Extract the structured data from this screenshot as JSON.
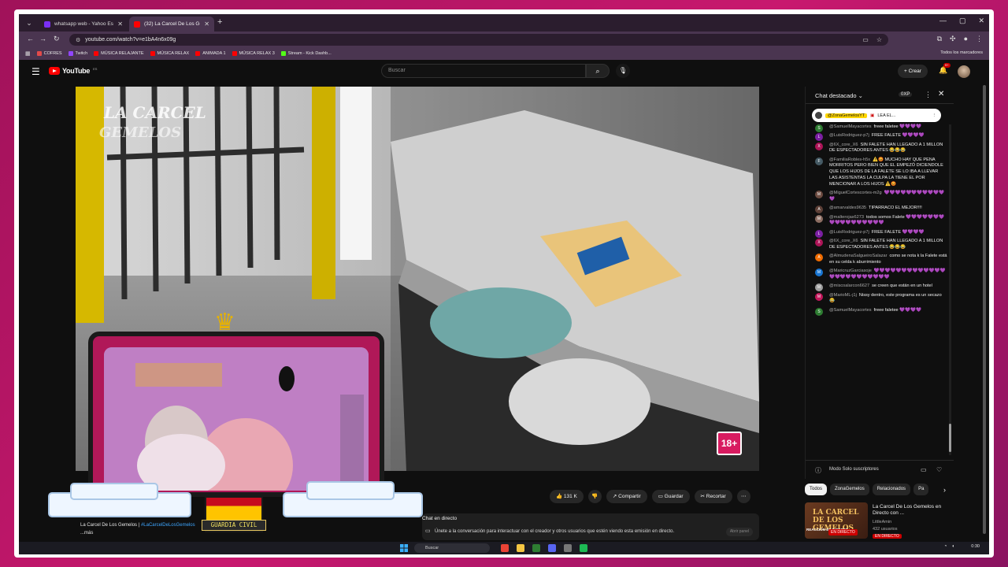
{
  "browser": {
    "tabs": [
      {
        "title": "whatsapp web - Yahoo España",
        "favicon_color": "#7b2ff7"
      },
      {
        "title": "(32) La Carcel De Los Gemel",
        "favicon_color": "#ff0000"
      }
    ],
    "url": "youtube.com/watch?v=e1bA4n6x09g",
    "bookmarks": [
      {
        "label": "COFRES",
        "color": "#e24a4a"
      },
      {
        "label": "Twitch",
        "color": "#9146ff"
      },
      {
        "label": "MÚSICA RELAJANTE",
        "color": "#ff0000"
      },
      {
        "label": "MÚSICA RELAX",
        "color": "#ff0000"
      },
      {
        "label": "ANIMADA 1",
        "color": "#ff0000"
      },
      {
        "label": "MÚSICA RELAX 3",
        "color": "#ff0000"
      },
      {
        "label": "Stream - Kick Dashb...",
        "color": "#53fc18"
      }
    ],
    "all_bookmarks": "Todos los marcadores"
  },
  "youtube": {
    "logo": "YouTube",
    "logo_region": "ES",
    "search_placeholder": "Buscar",
    "create_label": "+ Crear",
    "notif_count": "9+"
  },
  "video": {
    "age_badge": "18+",
    "overlay_label": "GUARDIA CIVIL",
    "actions": {
      "likes": "131 K",
      "share": "Compartir",
      "save": "Guardar",
      "clip": "Recortar"
    }
  },
  "description": {
    "title_prefix": "La Carcel De Los Gemelos |",
    "hashtag": "#LaCarcelDeLosGemelos",
    "more": "...más"
  },
  "live_chat_info": {
    "title": "Chat en directo",
    "text": "Únete a la conversación para interactuar con el creador y otros usuarios que estén viendo esta emisión en directo.",
    "button": "Abrir panel"
  },
  "chat": {
    "title": "Chat destacado",
    "xp": "0XP",
    "pinned_user": "@ZonaGemelosYT",
    "pinned_text": "LEA EL...",
    "messages": [
      {
        "initial": "S",
        "color": "#2e7d32",
        "author": "@SamuelMayacortes",
        "text": "freee faletee 💜💜💜💜"
      },
      {
        "initial": "L",
        "color": "#7b1fa2",
        "author": "@LuisRodriguez-p7j",
        "text": "FREE FALETE 💜💜💜💜"
      },
      {
        "initial": "X",
        "color": "#ad1457",
        "author": "@6X_core_X6",
        "text": "SIN FALETE HAN LLEGADO A 1 MILLON DE ESPECTADORES ANTES 😂😂😂"
      },
      {
        "initial": "F",
        "color": "#455a64",
        "author": "@FamiliaRobles-h5x",
        "text": "⚠️😡 MUCHO HAY QUE PENA MORRITOS PERO BIEN QUE EL EMPEZÓ DICIENDOLE QUE LOS HIJOS DE LA FALETE SE LO IBA A LLEVAR LAS ASISTENTAS LA CULPA LA TIENE EL POR MENCIONAR A LOS HIJOS ⚠️😡"
      },
      {
        "initial": "M",
        "color": "#6d4c41",
        "author": "@MiguelCortescortes-m2g",
        "text": "💜💜💜💜💜💜💜💜💜💜💜💜"
      },
      {
        "initial": "A",
        "color": "#5d4037",
        "author": "@amarvaldes9635",
        "text": "TIPARRACO EL MEJOR!!!!"
      },
      {
        "initial": "M",
        "color": "#8d6e63",
        "author": "@malterojas6273",
        "text": "todos somos Falete 💜💜💜💜💜💜💜💜💜💜💜💜💜💜💜💜💜"
      },
      {
        "initial": "L",
        "color": "#7b1fa2",
        "author": "@LuisRodriguez-p7j",
        "text": "FREE FALETE 💜💜💜💜"
      },
      {
        "initial": "X",
        "color": "#ad1457",
        "author": "@6X_core_X6",
        "text": "SIN FALETE HAN LLEGADO A 1 MILLON DE ESPECTADORES ANTES 😂😂😂"
      },
      {
        "initial": "A",
        "color": "#ef6c00",
        "author": "@AlmudenaSalgueiroSalazar",
        "text": "como se nota k la Falete está en su celda k aburrimiento"
      },
      {
        "initial": "M",
        "color": "#1976d2",
        "author": "@MaricruzGarciasoje",
        "text": "💜💜💜💜💜💜💜💜💜💜💜💜💜💜💜💜💜💜💜💜💜💜💜💜"
      },
      {
        "initial": "M",
        "color": "#9e9e9e",
        "author": "@miscoalarcon6627",
        "text": "se creen que están en un hotel"
      },
      {
        "initial": "M",
        "color": "#c2185b",
        "author": "@MarioML-j1j",
        "text": "Nissy dentro, este programa es un secazo 😂"
      },
      {
        "initial": "S",
        "color": "#2e7d32",
        "author": "@SamuelMayacortes",
        "text": "freee faletee 💜💜💜💜"
      }
    ],
    "footer_mode": "Modo Solo suscriptores"
  },
  "chips": [
    "Todos",
    "ZonaGemelos",
    "Relacionados",
    "Pa"
  ],
  "recommendation": {
    "thumb_text": "LA CARCEL DE LOS GEMELOS",
    "thumb_react": "REACCIÓN EN DIRECTO",
    "thumb_live": "EN DIRECTO",
    "title": "La Carcel De Los Gemelos en Directo con ...",
    "channel": "LittleAmin",
    "viewers": "432 usuarios",
    "badge": "EN DIRECTO"
  },
  "taskbar": {
    "search": "Buscar",
    "clock": "0:30"
  }
}
